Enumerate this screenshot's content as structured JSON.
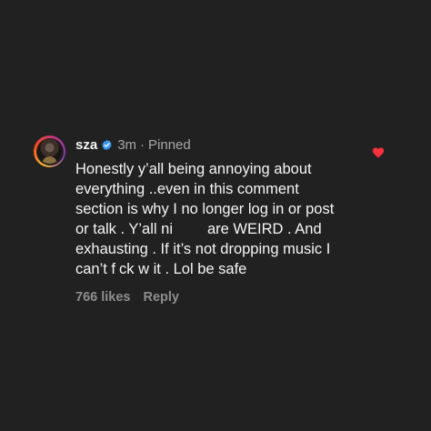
{
  "comment": {
    "username": "sza",
    "time": "3m",
    "separator": "·",
    "pinned_label": "Pinned",
    "text_lines": {
      "line1": "Honestly y’all being annoying about",
      "line2": "everything ..even in this comment",
      "line3": "section is why I no longer log in or post",
      "line4a": "or talk . Y’all ni",
      "line4b": "are WEIRD . And",
      "line5": "exhausting . If it’s not dropping music I",
      "line6a": "can’t f",
      "line6b": "ck w it . Lol be safe"
    },
    "likes_label": "766 likes",
    "reply_label": "Reply",
    "icons": {
      "verified": "verified-badge-icon",
      "like": "heart-icon"
    },
    "colors": {
      "background": "#212121",
      "verified": "#3897f0",
      "heart": "#ff3040"
    }
  }
}
